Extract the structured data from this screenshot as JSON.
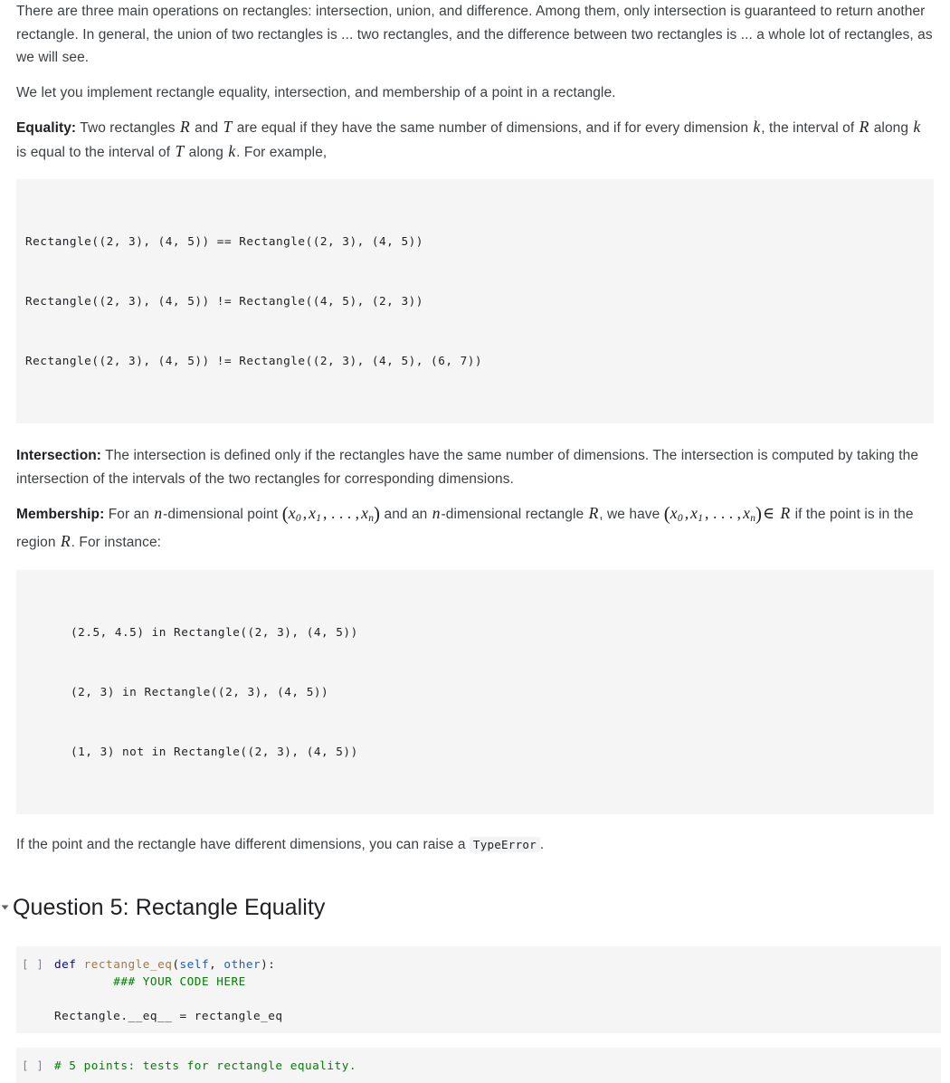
{
  "document": {
    "paragraphs": [
      {
        "id": "intro",
        "text": "There are three main operations on rectangles: intersection, union, and difference. Among them, only intersection is guaranteed to return another rectangle. In general, the union of two rectangles is ... two rectangles, and the difference between two rectangles is ... a whole lot of rectangles, as we will see."
      },
      {
        "id": "implement-note",
        "text": "We let you implement rectangle equality, intersection, and membership of a point in a rectangle."
      }
    ],
    "equality": {
      "lead": "Equality:",
      "part1": "Two rectangles",
      "var_r": "R",
      "part2": "and",
      "var_t": "T",
      "part3": "are equal if they have the same number of dimensions, and if for every dimension",
      "var_k": "k",
      "part4": ", the interval of",
      "var_r2": "R",
      "part5": "along",
      "var_k2": "k",
      "part6": "is equal to the interval of",
      "var_t2": "T",
      "part7": "along",
      "var_k3": "k",
      "part8": ". For example,"
    },
    "equality_code": {
      "lines": [
        "Rectangle((2, 3), (4, 5)) == Rectangle((2, 3), (4, 5))",
        "Rectangle((2, 3), (4, 5)) != Rectangle((4, 5), (2, 3))",
        "Rectangle((2, 3), (4, 5)) != Rectangle((2, 3), (4, 5), (6, 7))"
      ]
    },
    "intersection": {
      "lead": "Intersection:",
      "text": "The intersection is defined only if the rectangles have the same number of dimensions. The intersection is computed by taking the intersection of the intervals of the two rectangles for corresponding dimensions."
    },
    "membership": {
      "lead": "Membership:",
      "part1": "For an",
      "var_n": "n",
      "part2": "-dimensional point",
      "tuple_open": "(",
      "x0": "x",
      "x0sub": "0",
      "comma1": ",",
      "x1": "x",
      "x1sub": "1",
      "ellipsis": ", . . . ,",
      "xn": "x",
      "xnsub": "n",
      "tuple_close": ")",
      "part3": "and an",
      "var_n2": "n",
      "part4": "-dimensional rectangle",
      "var_r": "R",
      "part5": ", we have",
      "member_op": "∈",
      "var_r2": "R",
      "part6": "if the point is in the region",
      "var_r3": "R",
      "part7": ". For instance:"
    },
    "membership_code": {
      "lines": [
        "(2.5, 4.5) in Rectangle((2, 3), (4, 5))",
        "(2, 3) in Rectangle((2, 3), (4, 5))",
        "(1, 3) not in Rectangle((2, 3), (4, 5))"
      ]
    },
    "typeerror_note": {
      "part1": "If the point and the rectangle have different dimensions, you can raise a",
      "code": "TypeError",
      "part2": "."
    },
    "question_heading": {
      "collapse_marker": "▾",
      "title": "Question 5: Rectangle Equality"
    },
    "cells": [
      {
        "id": "cell-rectangle-eq",
        "prompt": "[ ]",
        "tokens": [
          {
            "t": "def",
            "c": "kw"
          },
          {
            "t": " ",
            "c": "pl"
          },
          {
            "t": "rectangle_eq",
            "c": "fn"
          },
          {
            "t": "(",
            "c": "op"
          },
          {
            "t": "self",
            "c": "par"
          },
          {
            "t": ", ",
            "c": "op"
          },
          {
            "t": "other",
            "c": "par"
          },
          {
            "t": "):",
            "c": "op"
          },
          {
            "t": "\n        ",
            "c": "pl"
          },
          {
            "t": "### YOUR CODE HERE",
            "c": "cm"
          },
          {
            "t": "\n\n",
            "c": "pl"
          },
          {
            "t": "Rectangle.__eq__ = rectangle_eq",
            "c": "pl"
          }
        ]
      },
      {
        "id": "cell-tests",
        "prompt": "[ ]",
        "tokens": [
          {
            "t": "# 5 points: tests for rectangle equality.",
            "c": "cm"
          }
        ]
      }
    ]
  }
}
